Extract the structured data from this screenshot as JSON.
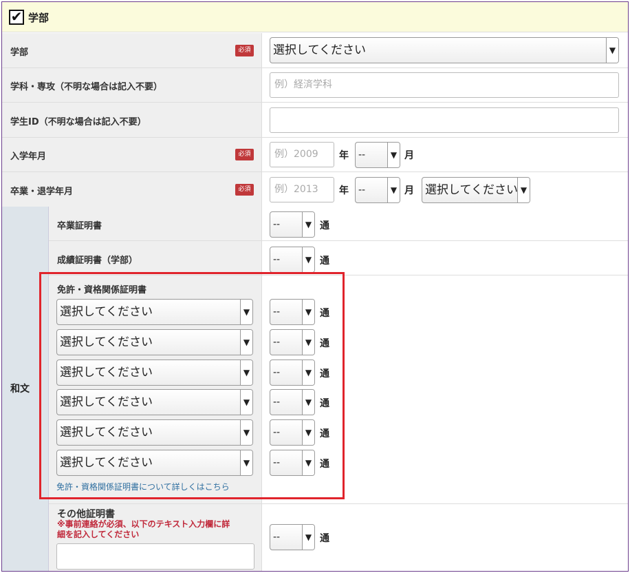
{
  "section": {
    "title": "学部",
    "checked": "✔"
  },
  "rows": {
    "faculty": {
      "label": "学部",
      "required": "必須",
      "select_value": "選択してください"
    },
    "department": {
      "label": "学科・専攻（不明な場合は記入不要）",
      "placeholder": "例）経済学科"
    },
    "student_id": {
      "label": "学生ID（不明な場合は記入不要）",
      "value": ""
    },
    "admission": {
      "label": "入学年月",
      "required": "必須",
      "year_placeholder": "例）2009",
      "year_unit": "年",
      "month_value": "--",
      "month_unit": "月"
    },
    "graduation": {
      "label": "卒業・退学年月",
      "required": "必須",
      "year_placeholder": "例）2013",
      "year_unit": "年",
      "month_value": "--",
      "month_unit": "月",
      "status_value": "選択してください"
    }
  },
  "japanese": {
    "label": "和文",
    "graduation_cert": {
      "label": "卒業証明書",
      "count_value": "--",
      "count_unit": "通"
    },
    "transcript": {
      "label": "成績証明書（学部）",
      "count_value": "--",
      "count_unit": "通"
    },
    "license": {
      "label": "免許・資格関係証明書",
      "items": [
        {
          "select_value": "選択してください",
          "count_value": "--",
          "count_unit": "通"
        },
        {
          "select_value": "選択してください",
          "count_value": "--",
          "count_unit": "通"
        },
        {
          "select_value": "選択してください",
          "count_value": "--",
          "count_unit": "通"
        },
        {
          "select_value": "選択してください",
          "count_value": "--",
          "count_unit": "通"
        },
        {
          "select_value": "選択してください",
          "count_value": "--",
          "count_unit": "通"
        },
        {
          "select_value": "選択してください",
          "count_value": "--",
          "count_unit": "通"
        }
      ],
      "link": "免許・資格関係証明書について詳しくはこちら"
    },
    "other_cert": {
      "label": "その他証明書",
      "note_line1": "※事前連絡が必須、以下のテキスト入力欄に詳",
      "note_line2": "細を記入してください",
      "text_value": "",
      "count_value": "--",
      "count_unit": "通"
    }
  },
  "icons": {
    "chevron": "chevron-down-icon",
    "check": "checkmark-icon"
  },
  "colors": {
    "required_badge": "#c0383a",
    "highlight_border": "#e0242c",
    "link": "#2f6fa0",
    "note": "#c0283a",
    "section_bg": "#fbfbdc"
  }
}
